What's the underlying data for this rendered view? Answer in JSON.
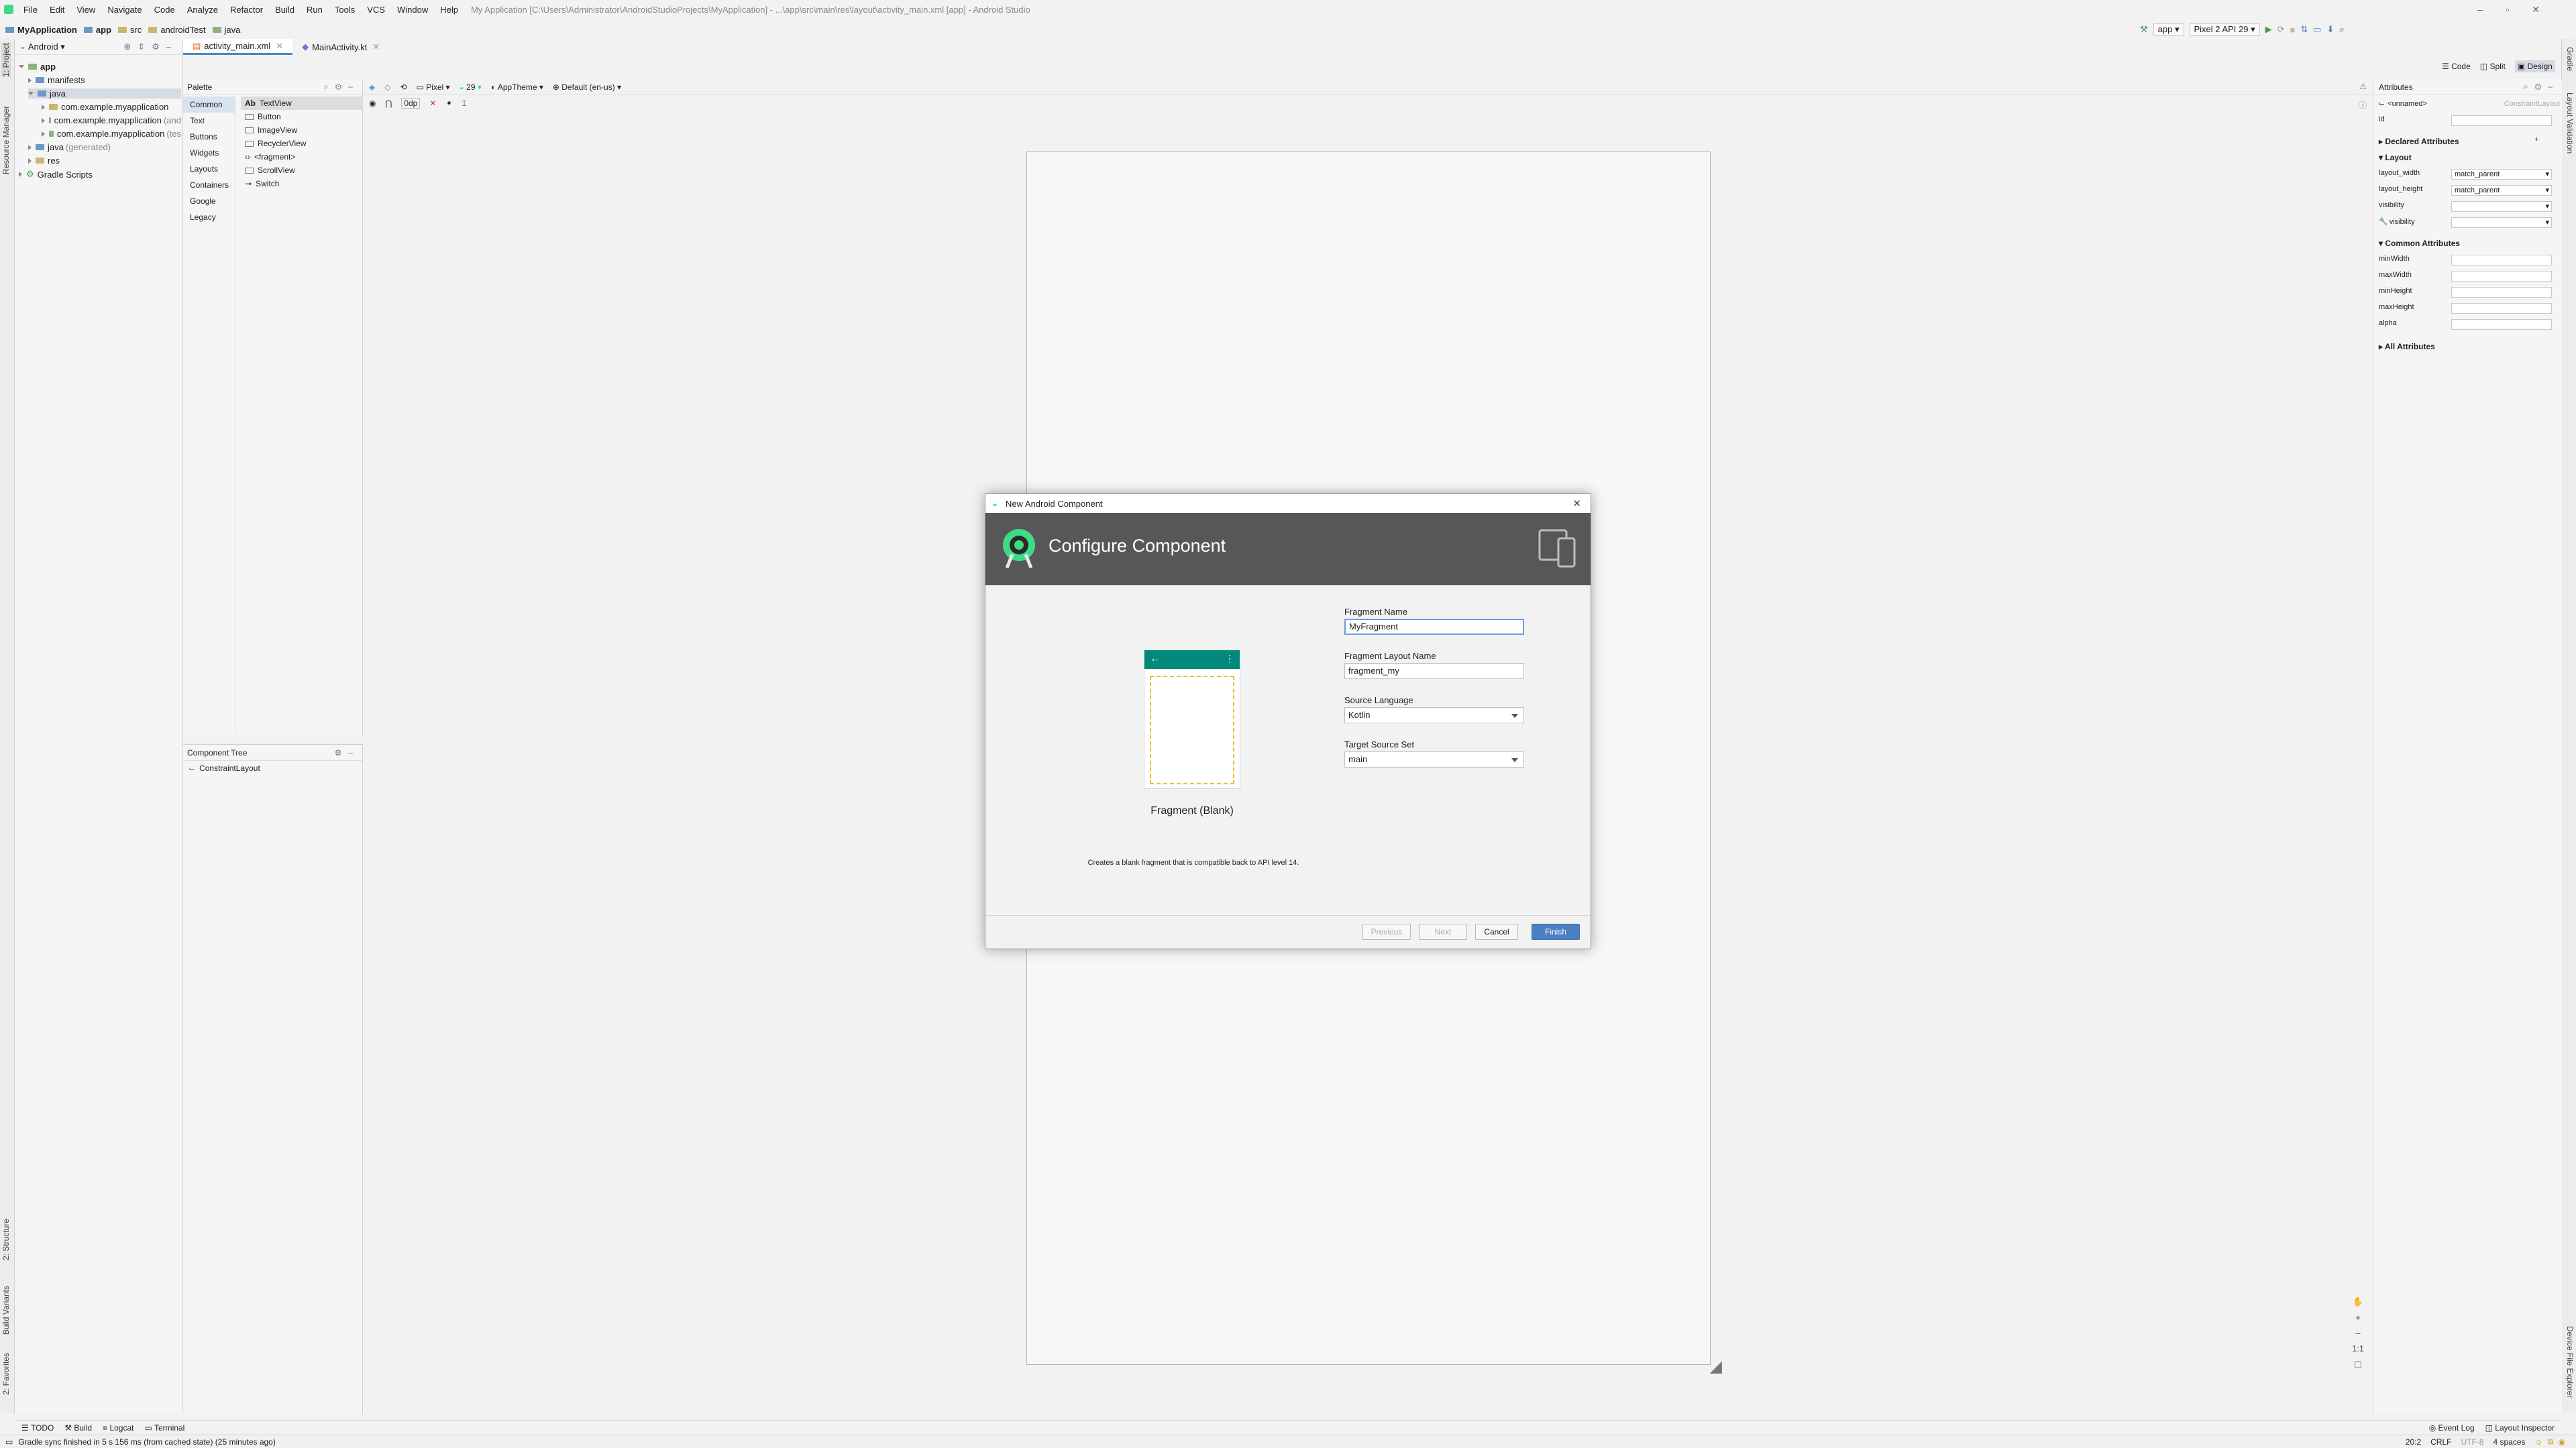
{
  "menu": {
    "items": [
      "File",
      "Edit",
      "View",
      "Navigate",
      "Code",
      "Analyze",
      "Refactor",
      "Build",
      "Run",
      "Tools",
      "VCS",
      "Window",
      "Help"
    ],
    "window_title": "My Application [C:\\Users\\Administrator\\AndroidStudioProjects\\MyApplication] - ...\\app\\src\\main\\res\\layout\\activity_main.xml [app] - Android Studio"
  },
  "breadcrumb": [
    "MyApplication",
    "app",
    "src",
    "androidTest",
    "java"
  ],
  "toolbar": {
    "run_config": "app",
    "device": "Pixel 2 API 29"
  },
  "project": {
    "view": "Android",
    "tree": [
      {
        "label": "app",
        "level": 0
      },
      {
        "label": "manifests",
        "level": 1
      },
      {
        "label": "java",
        "level": 1
      },
      {
        "label": "com.example.myapplication",
        "level": 2,
        "suffix": ""
      },
      {
        "label": "com.example.myapplication",
        "level": 2,
        "suffix": "(and"
      },
      {
        "label": "com.example.myapplication",
        "level": 2,
        "suffix": "(tes"
      },
      {
        "label": "java",
        "level": 1,
        "suffix": "(generated)"
      },
      {
        "label": "res",
        "level": 1
      },
      {
        "label": "Gradle Scripts",
        "level": 0
      }
    ]
  },
  "left_strip": {
    "project": "1: Project",
    "resource": "Resource Manager",
    "structure": "2: Structure",
    "build_variants": "Build Variants",
    "favorites": "2: Favorites"
  },
  "right_strip": {
    "gradle": "Gradle",
    "layout_validation": "Layout Validation",
    "device_explorer": "Device File Explorer"
  },
  "editor_tabs": [
    "activity_main.xml",
    "MainActivity.kt"
  ],
  "view_modes": [
    "Code",
    "Split",
    "Design"
  ],
  "palette": {
    "title": "Palette",
    "categories": [
      "Common",
      "Text",
      "Buttons",
      "Widgets",
      "Layouts",
      "Containers",
      "Google",
      "Legacy"
    ],
    "items": [
      "TextView",
      "Button",
      "ImageView",
      "RecyclerView",
      "<fragment>",
      "ScrollView",
      "Switch"
    ]
  },
  "design_toolbar": {
    "device": "Pixel",
    "api": "29",
    "theme": "AppTheme",
    "locale": "Default (en-us)",
    "margin": "0dp"
  },
  "component_tree": {
    "title": "Component Tree",
    "root": "ConstraintLayout"
  },
  "attributes": {
    "title": "Attributes",
    "selected": "<unnamed>",
    "selected_type": "ConstraintLayout",
    "id_label": "id",
    "declared": "Declared Attributes",
    "layout": "Layout",
    "layout_rows": [
      {
        "name": "layout_width",
        "value": "match_parent"
      },
      {
        "name": "layout_height",
        "value": "match_parent"
      },
      {
        "name": "visibility",
        "value": ""
      },
      {
        "name": "visibility",
        "value": ""
      }
    ],
    "common": "Common Attributes",
    "common_rows": [
      "minWidth",
      "maxWidth",
      "minHeight",
      "maxHeight",
      "alpha"
    ],
    "all": "All Attributes"
  },
  "dialog": {
    "window_title": "New Android Component",
    "header": "Configure Component",
    "preview_label": "Fragment (Blank)",
    "description": "Creates a blank fragment that is compatible back to API level 14.",
    "fields": {
      "name_label": "Fragment Name",
      "name_value": "MyFragment",
      "layout_label": "Fragment Layout Name",
      "layout_value": "fragment_my",
      "lang_label": "Source Language",
      "lang_value": "Kotlin",
      "set_label": "Target Source Set",
      "set_value": "main"
    },
    "buttons": {
      "previous": "Previous",
      "next": "Next",
      "cancel": "Cancel",
      "finish": "Finish"
    }
  },
  "bottom_tabs": [
    "TODO",
    "Build",
    "Logcat",
    "Terminal"
  ],
  "bottom_right_tabs": [
    "Event Log",
    "Layout Inspector"
  ],
  "status": {
    "message": "Gradle sync finished in 5 s 156 ms (from cached state) (25 minutes ago)",
    "position": "20:2",
    "line_sep": "CRLF",
    "encoding": "UTF-8",
    "indent": "4 spaces"
  },
  "zoom": {
    "ratio": "1:1"
  },
  "colors": {
    "accent": "#4a88c7",
    "header_bg": "#575757",
    "android_green": "#3ddc84",
    "teal": "#00897b",
    "placeholder_yellow": "#e0c431"
  }
}
